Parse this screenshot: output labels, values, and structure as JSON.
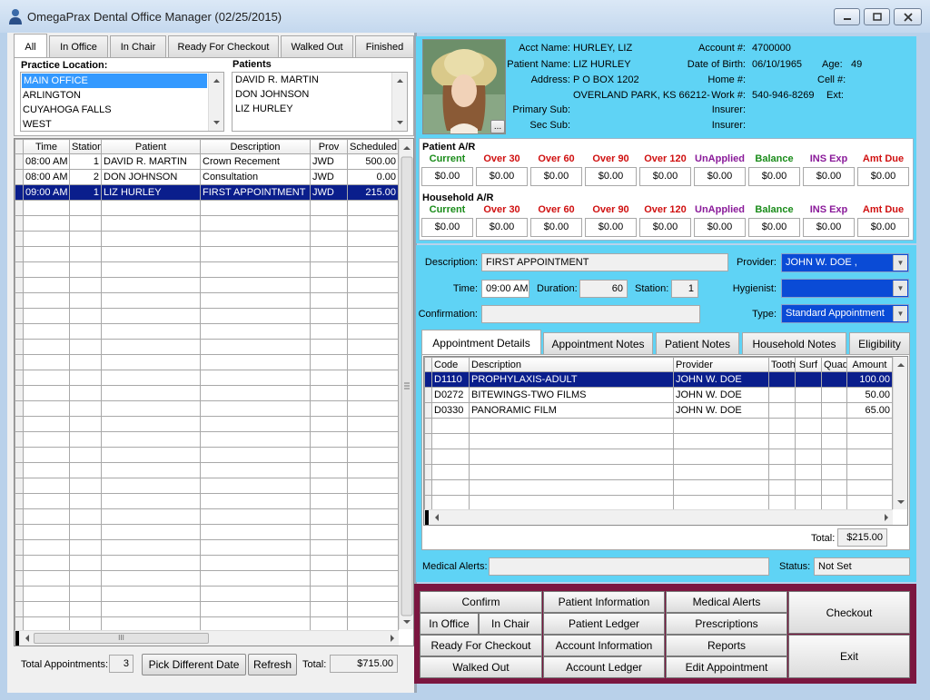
{
  "window": {
    "title": "OmegaPrax Dental Office Manager (02/25/2015)"
  },
  "tabs": [
    "All",
    "In Office",
    "In Chair",
    "Ready For Checkout",
    "Walked Out",
    "Finished"
  ],
  "practice_location": {
    "label": "Practice Location:",
    "items": [
      "MAIN OFFICE",
      "ARLINGTON",
      "CUYAHOGA FALLS",
      "WEST"
    ]
  },
  "patients_list": {
    "label": "Patients",
    "items": [
      "DAVID R. MARTIN",
      "DON JOHNSON",
      "LIZ HURLEY"
    ]
  },
  "schedule": {
    "headers": [
      "Time",
      "Station",
      "Patient",
      "Description",
      "Prov",
      "Scheduled"
    ],
    "rows": [
      {
        "time": "08:00 AM",
        "station": "1",
        "patient": "DAVID R. MARTIN",
        "description": "Crown Recement",
        "prov": "JWD",
        "scheduled": "500.00"
      },
      {
        "time": "08:00 AM",
        "station": "2",
        "patient": "DON JOHNSON",
        "description": "Consultation",
        "prov": "JWD",
        "scheduled": "0.00"
      },
      {
        "time": "09:00 AM",
        "station": "1",
        "patient": "LIZ HURLEY",
        "description": "FIRST APPOINTMENT",
        "prov": "JWD",
        "scheduled": "215.00"
      }
    ],
    "hscroll_grip": "III"
  },
  "footer_left": {
    "total_appts_label": "Total Appointments:",
    "total_appts": "3",
    "pick_date": "Pick Different Date",
    "refresh": "Refresh",
    "total_label": "Total:",
    "total": "$715.00"
  },
  "patient": {
    "acct_name_label": "Acct Name:",
    "acct_name": "HURLEY, LIZ",
    "patient_name_label": "Patient Name:",
    "patient_name": "LIZ HURLEY",
    "address_label": "Address:",
    "address1": "P O BOX 1202",
    "address2": "OVERLAND PARK, KS 66212-",
    "primary_sub_label": "Primary Sub:",
    "sec_sub_label": "Sec Sub:",
    "acct_num_label": "Account #:",
    "acct_num": "4700000",
    "dob_label": "Date of Birth:",
    "dob": "06/10/1965",
    "age_label": "Age:",
    "age": "49",
    "home_label": "Home #:",
    "cell_label": "Cell #:",
    "work_label": "Work #:",
    "work": "540-946-8269",
    "ext_label": "Ext:",
    "insurer1_label": "Insurer:",
    "insurer2_label": "Insurer:",
    "photo_btn": "..."
  },
  "ar": {
    "patient_label": "Patient A/R",
    "household_label": "Household A/R",
    "columns": [
      {
        "label": "Current",
        "color": "#1a8c1a"
      },
      {
        "label": "Over 30",
        "color": "#d01010"
      },
      {
        "label": "Over 60",
        "color": "#d01010"
      },
      {
        "label": "Over 90",
        "color": "#d01010"
      },
      {
        "label": "Over 120",
        "color": "#d01010"
      },
      {
        "label": "UnApplied",
        "color": "#8a1a9a"
      },
      {
        "label": "Balance",
        "color": "#1a8c1a"
      },
      {
        "label": "INS Exp",
        "color": "#8a1a9a"
      },
      {
        "label": "Amt Due",
        "color": "#d01010"
      }
    ],
    "patient_values": [
      "$0.00",
      "$0.00",
      "$0.00",
      "$0.00",
      "$0.00",
      "$0.00",
      "$0.00",
      "$0.00",
      "$0.00"
    ],
    "household_values": [
      "$0.00",
      "$0.00",
      "$0.00",
      "$0.00",
      "$0.00",
      "$0.00",
      "$0.00",
      "$0.00",
      "$0.00"
    ]
  },
  "appointment": {
    "description_label": "Description:",
    "description": "FIRST APPOINTMENT",
    "time_label": "Time:",
    "time": "09:00 AM",
    "duration_label": "Duration:",
    "duration": "60",
    "station_label": "Station:",
    "station": "1",
    "confirmation_label": "Confirmation:",
    "confirmation": "",
    "provider_label": "Provider:",
    "provider": "JOHN W. DOE ,",
    "hygienist_label": "Hygienist:",
    "hygienist": "",
    "type_label": "Type:",
    "type": "Standard Appointment"
  },
  "detail_tabs": [
    "Appointment Details",
    "Appointment Notes",
    "Patient Notes",
    "Household Notes",
    "Eligibility"
  ],
  "procedures": {
    "headers": [
      "Code",
      "Description",
      "Provider",
      "Tooth",
      "Surf",
      "Quad",
      "Amount"
    ],
    "rows": [
      {
        "code": "D1110",
        "description": "PROPHYLAXIS-ADULT",
        "provider": "JOHN W. DOE",
        "tooth": "",
        "surf": "",
        "quad": "",
        "amount": "100.00"
      },
      {
        "code": "D0272",
        "description": "BITEWINGS-TWO FILMS",
        "provider": "JOHN W. DOE",
        "tooth": "",
        "surf": "",
        "quad": "",
        "amount": "50.00"
      },
      {
        "code": "D0330",
        "description": "PANORAMIC FILM",
        "provider": "JOHN W. DOE",
        "tooth": "",
        "surf": "",
        "quad": "",
        "amount": "65.00"
      }
    ],
    "total_label": "Total:",
    "total": "$215.00"
  },
  "medical": {
    "alerts_label": "Medical Alerts:",
    "alerts": "",
    "status_label": "Status:",
    "status": "Not Set"
  },
  "buttons": {
    "confirm": "Confirm",
    "in_office": "In Office",
    "in_chair": "In Chair",
    "ready_checkout": "Ready For Checkout",
    "walked_out": "Walked Out",
    "patient_info": "Patient Information",
    "patient_ledger": "Patient Ledger",
    "account_info": "Account Information",
    "account_ledger": "Account Ledger",
    "medical_alerts": "Medical Alerts",
    "prescriptions": "Prescriptions",
    "reports": "Reports",
    "edit_appointment": "Edit Appointment",
    "checkout": "Checkout",
    "exit": "Exit"
  }
}
